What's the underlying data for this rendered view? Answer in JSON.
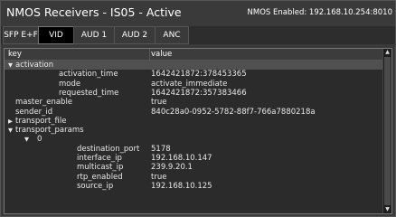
{
  "window": {
    "title": "NMOS Receivers - IS05 - Active",
    "status": "NMOS Enabled: 192.168.10.254:8010"
  },
  "tabs": [
    {
      "label": "SFP E+F",
      "active": false
    },
    {
      "label": "VID",
      "active": true
    },
    {
      "label": "AUD 1",
      "active": false
    },
    {
      "label": "AUD 2",
      "active": false
    },
    {
      "label": "ANC",
      "active": false
    }
  ],
  "table": {
    "headers": {
      "key": "key",
      "value": "value"
    },
    "rows": [
      {
        "key": "activation",
        "value": "",
        "arrow": "down",
        "depth": 0,
        "selected": true
      },
      {
        "key": "activation_time",
        "value": "1642421872:378453365",
        "arrow": "",
        "depth": 2,
        "selected": false
      },
      {
        "key": "mode",
        "value": "activate_immediate",
        "arrow": "",
        "depth": 2,
        "selected": false
      },
      {
        "key": "requested_time",
        "value": "1642421872:357383466",
        "arrow": "",
        "depth": 2,
        "selected": false
      },
      {
        "key": "master_enable",
        "value": "true",
        "arrow": "",
        "depth": 0,
        "selected": false
      },
      {
        "key": "sender_id",
        "value": "840c28a0-0952-5782-88f7-766a7880218a",
        "arrow": "",
        "depth": 0,
        "selected": false
      },
      {
        "key": "transport_file",
        "value": "",
        "arrow": "right",
        "depth": 0,
        "selected": false
      },
      {
        "key": "transport_params",
        "value": "",
        "arrow": "down",
        "depth": 0,
        "selected": false
      },
      {
        "key": "0",
        "value": "",
        "arrow": "down",
        "depth": 1,
        "selected": false
      },
      {
        "key": "destination_port",
        "value": "5178",
        "arrow": "",
        "depth": 3,
        "selected": false
      },
      {
        "key": "interface_ip",
        "value": "192.168.10.147",
        "arrow": "",
        "depth": 3,
        "selected": false
      },
      {
        "key": "multicast_ip",
        "value": "239.9.20.1",
        "arrow": "",
        "depth": 3,
        "selected": false
      },
      {
        "key": "rtp_enabled",
        "value": "true",
        "arrow": "",
        "depth": 3,
        "selected": false
      },
      {
        "key": "source_ip",
        "value": "192.168.10.125",
        "arrow": "",
        "depth": 3,
        "selected": false
      }
    ]
  },
  "scrollbar": {
    "up_icon": "triangle-up-icon",
    "down_icon": "triangle-down-icon"
  }
}
